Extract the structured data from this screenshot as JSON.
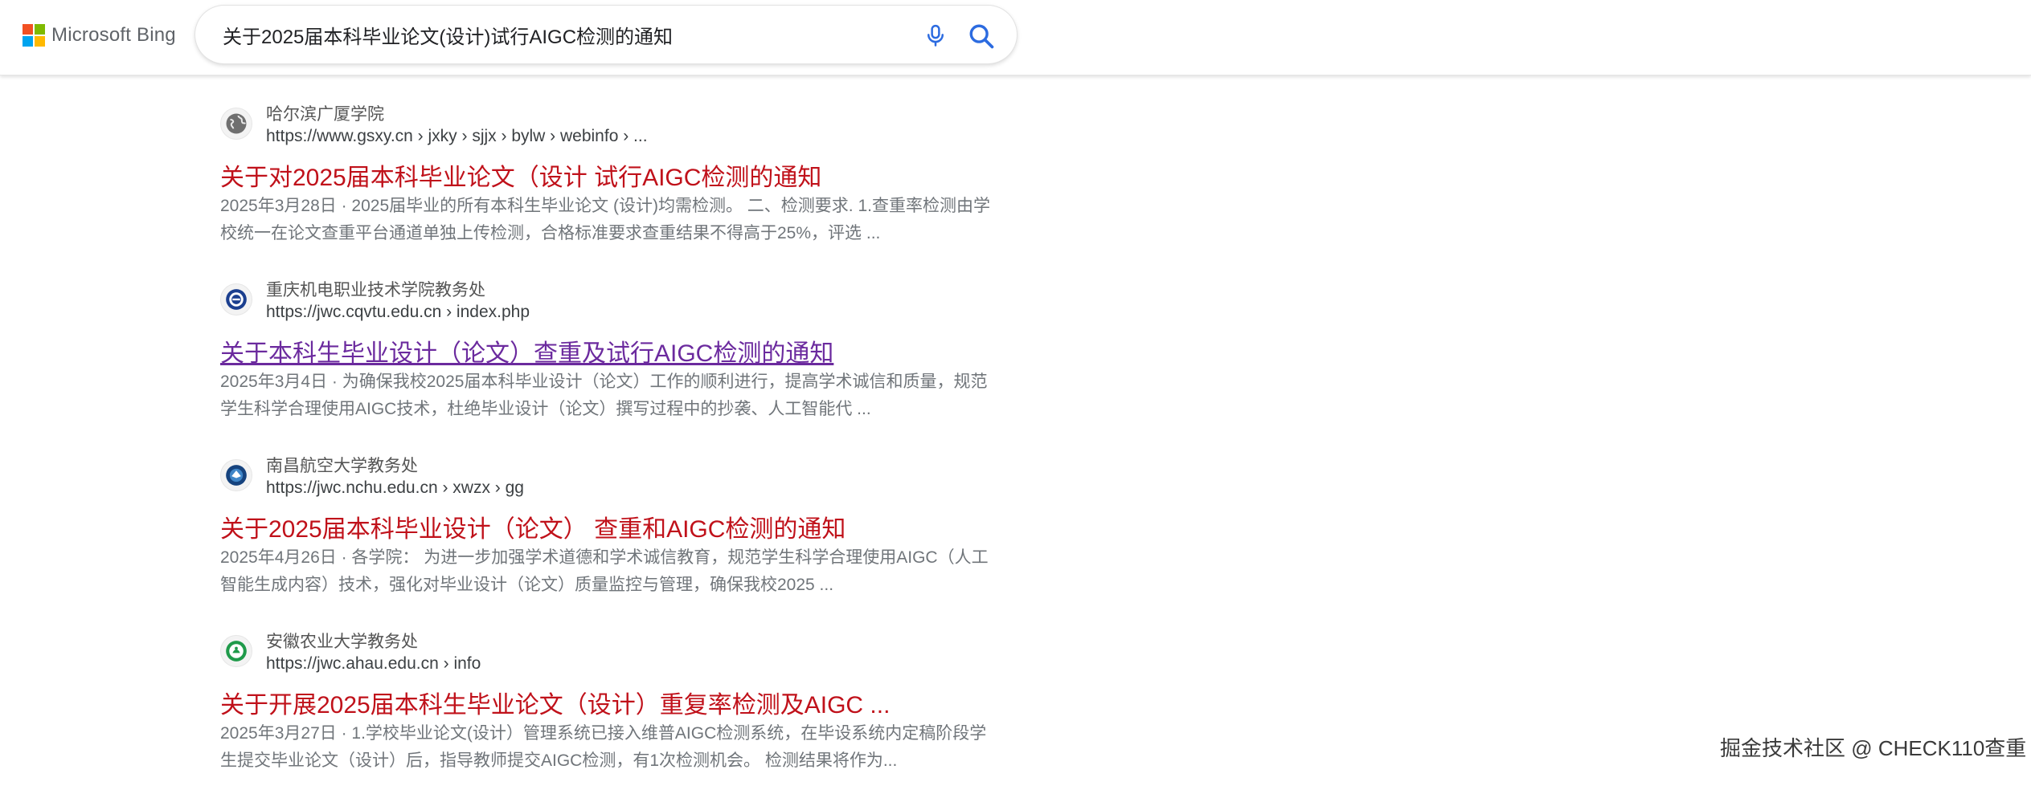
{
  "brand": {
    "logo_text": "Microsoft Bing",
    "logo_colors": [
      "#f25022",
      "#7fba00",
      "#00a4ef",
      "#ffb900"
    ]
  },
  "search": {
    "query": "关于2025届本科毕业论文(设计)试行AIGC检测的通知",
    "mic_icon": "microphone-icon",
    "search_icon": "magnifier-icon"
  },
  "results": [
    {
      "site_name": "哈尔滨广厦学院",
      "url": "https://www.gsxy.cn › jxky › sjjx › bylw › webinfo › ...",
      "title": "关于对2025届本科毕业论文（设计 试行AIGC检测的通知",
      "visited": false,
      "date": "2025年3月28日 · ",
      "snippet": "2025届毕业的所有本科生毕业论文 (设计)均需检测。 二、检测要求. 1.查重率检测由学校统一在论文查重平台通道单独上传检测，合格标准要求查重结果不得高于25%，评选 ...",
      "favicon": "globe-icon"
    },
    {
      "site_name": "重庆机电职业技术学院教务处",
      "url": "https://jwc.cqvtu.edu.cn › index.php",
      "title": "关于本科生毕业设计（论文）查重及试行AIGC检测的通知",
      "visited": true,
      "date": "2025年3月4日 · ",
      "snippet": "为确保我校2025届本科毕业设计（论文）工作的顺利进行，提高学术诚信和质量，规范学生科学合理使用AIGC技术，杜绝毕业设计（论文）撰写过程中的抄袭、人工智能代 ...",
      "favicon": "university-seal-icon"
    },
    {
      "site_name": "南昌航空大学教务处",
      "url": "https://jwc.nchu.edu.cn › xwzx › gg",
      "title": "关于2025届本科毕业设计（论文） 查重和AIGC检测的通知",
      "visited": false,
      "date": "2025年4月26日 · ",
      "snippet": "各学院： 为进一步加强学术道德和学术诚信教育，规范学生科学合理使用AIGC（人工智能生成内容）技术，强化对毕业设计（论文）质量监控与管理，确保我校2025 ...",
      "favicon": "university-seal-icon"
    },
    {
      "site_name": "安徽农业大学教务处",
      "url": "https://jwc.ahau.edu.cn › info",
      "title": "关于开展2025届本科生毕业论文（设计）重复率检测及AIGC ...",
      "visited": false,
      "date": "2025年3月27日 · ",
      "snippet": "1.学校毕业论文(设计）管理系统已接入维普AIGC检测系统，在毕设系统内定稿阶段学生提交毕业论文（设计）后，指导教师提交AIGC检测，有1次检测机会。 检测结果将作为...",
      "favicon": "university-seal-icon"
    }
  ],
  "watermark": "掘金技术社区 @ CHECK110查重"
}
